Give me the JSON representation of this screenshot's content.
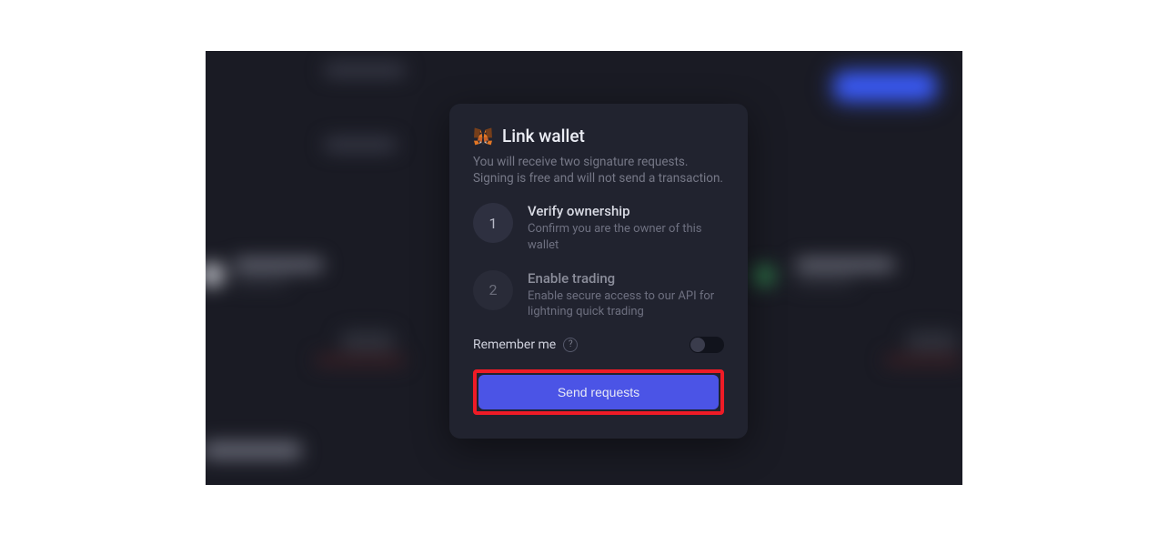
{
  "modal": {
    "title": "Link wallet",
    "subtitle": "You will receive two signature requests. Signing is free and will not send a transaction.",
    "steps": [
      {
        "num": "1",
        "title": "Verify ownership",
        "desc": "Confirm you are the owner of this wallet"
      },
      {
        "num": "2",
        "title": "Enable trading",
        "desc": "Enable secure access to our API for lightning quick trading"
      }
    ],
    "remember_label": "Remember me",
    "help_glyph": "?",
    "button_label": "Send requests",
    "wallet_icon": "metamask-fox"
  }
}
